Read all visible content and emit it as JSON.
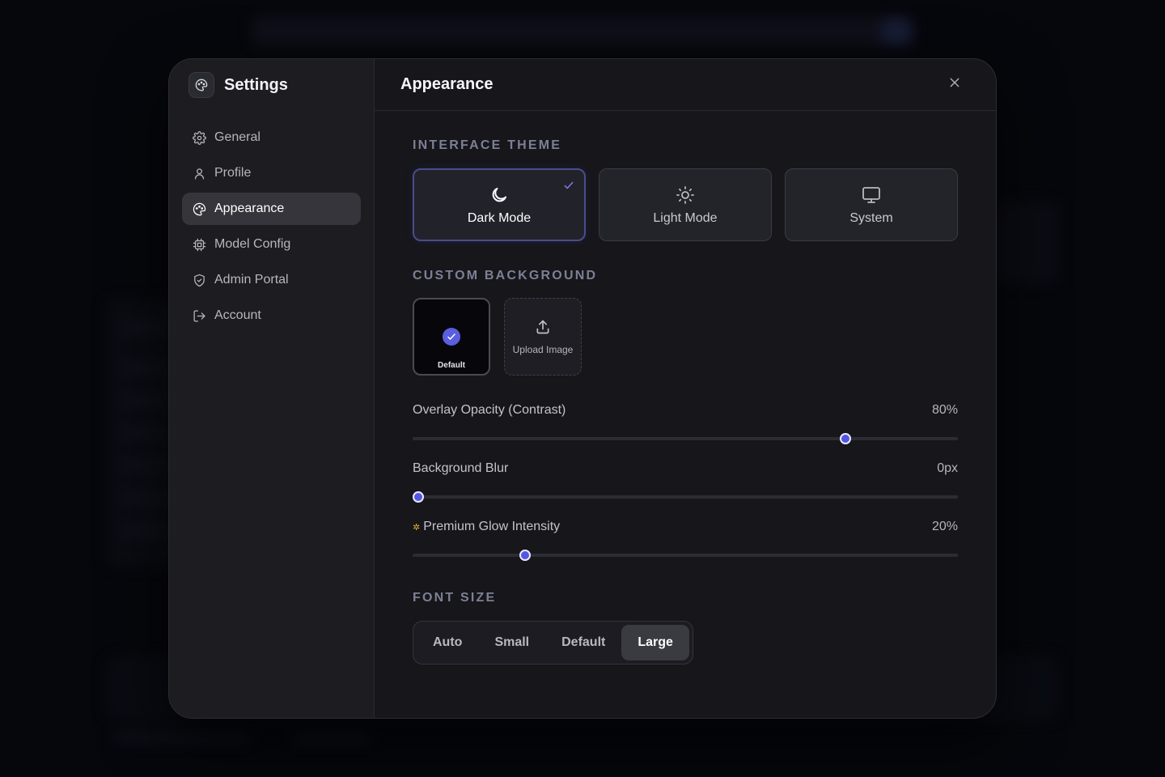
{
  "sidebar": {
    "title": "Settings",
    "items": [
      {
        "label": "General",
        "icon": "gear-icon"
      },
      {
        "label": "Profile",
        "icon": "user-icon"
      },
      {
        "label": "Appearance",
        "icon": "palette-icon",
        "active": true
      },
      {
        "label": "Model Config",
        "icon": "cpu-icon"
      },
      {
        "label": "Admin Portal",
        "icon": "shield-icon"
      },
      {
        "label": "Account",
        "icon": "logout-icon"
      }
    ]
  },
  "main": {
    "title": "Appearance",
    "interface_theme": {
      "label": "INTERFACE THEME",
      "options": [
        {
          "label": "Dark Mode",
          "icon": "moon-icon",
          "selected": true
        },
        {
          "label": "Light Mode",
          "icon": "sun-icon",
          "selected": false
        },
        {
          "label": "System",
          "icon": "monitor-icon",
          "selected": false
        }
      ]
    },
    "custom_background": {
      "label": "CUSTOM BACKGROUND",
      "default_label": "Default",
      "upload_label": "Upload Image"
    },
    "sliders": [
      {
        "label": "Overlay Opacity (Contrast)",
        "value": "80%",
        "fraction": 0.8
      },
      {
        "label": "Background Blur",
        "value": "0px",
        "fraction": 0.0
      },
      {
        "label": "Premium Glow Intensity",
        "value": "20%",
        "fraction": 0.2
      }
    ],
    "font_size": {
      "label": "FONT SIZE",
      "options": [
        "Auto",
        "Small",
        "Default",
        "Large"
      ],
      "selected": "Large"
    }
  },
  "colors": {
    "accent": "#5356e3",
    "glow": "#e0b030"
  }
}
